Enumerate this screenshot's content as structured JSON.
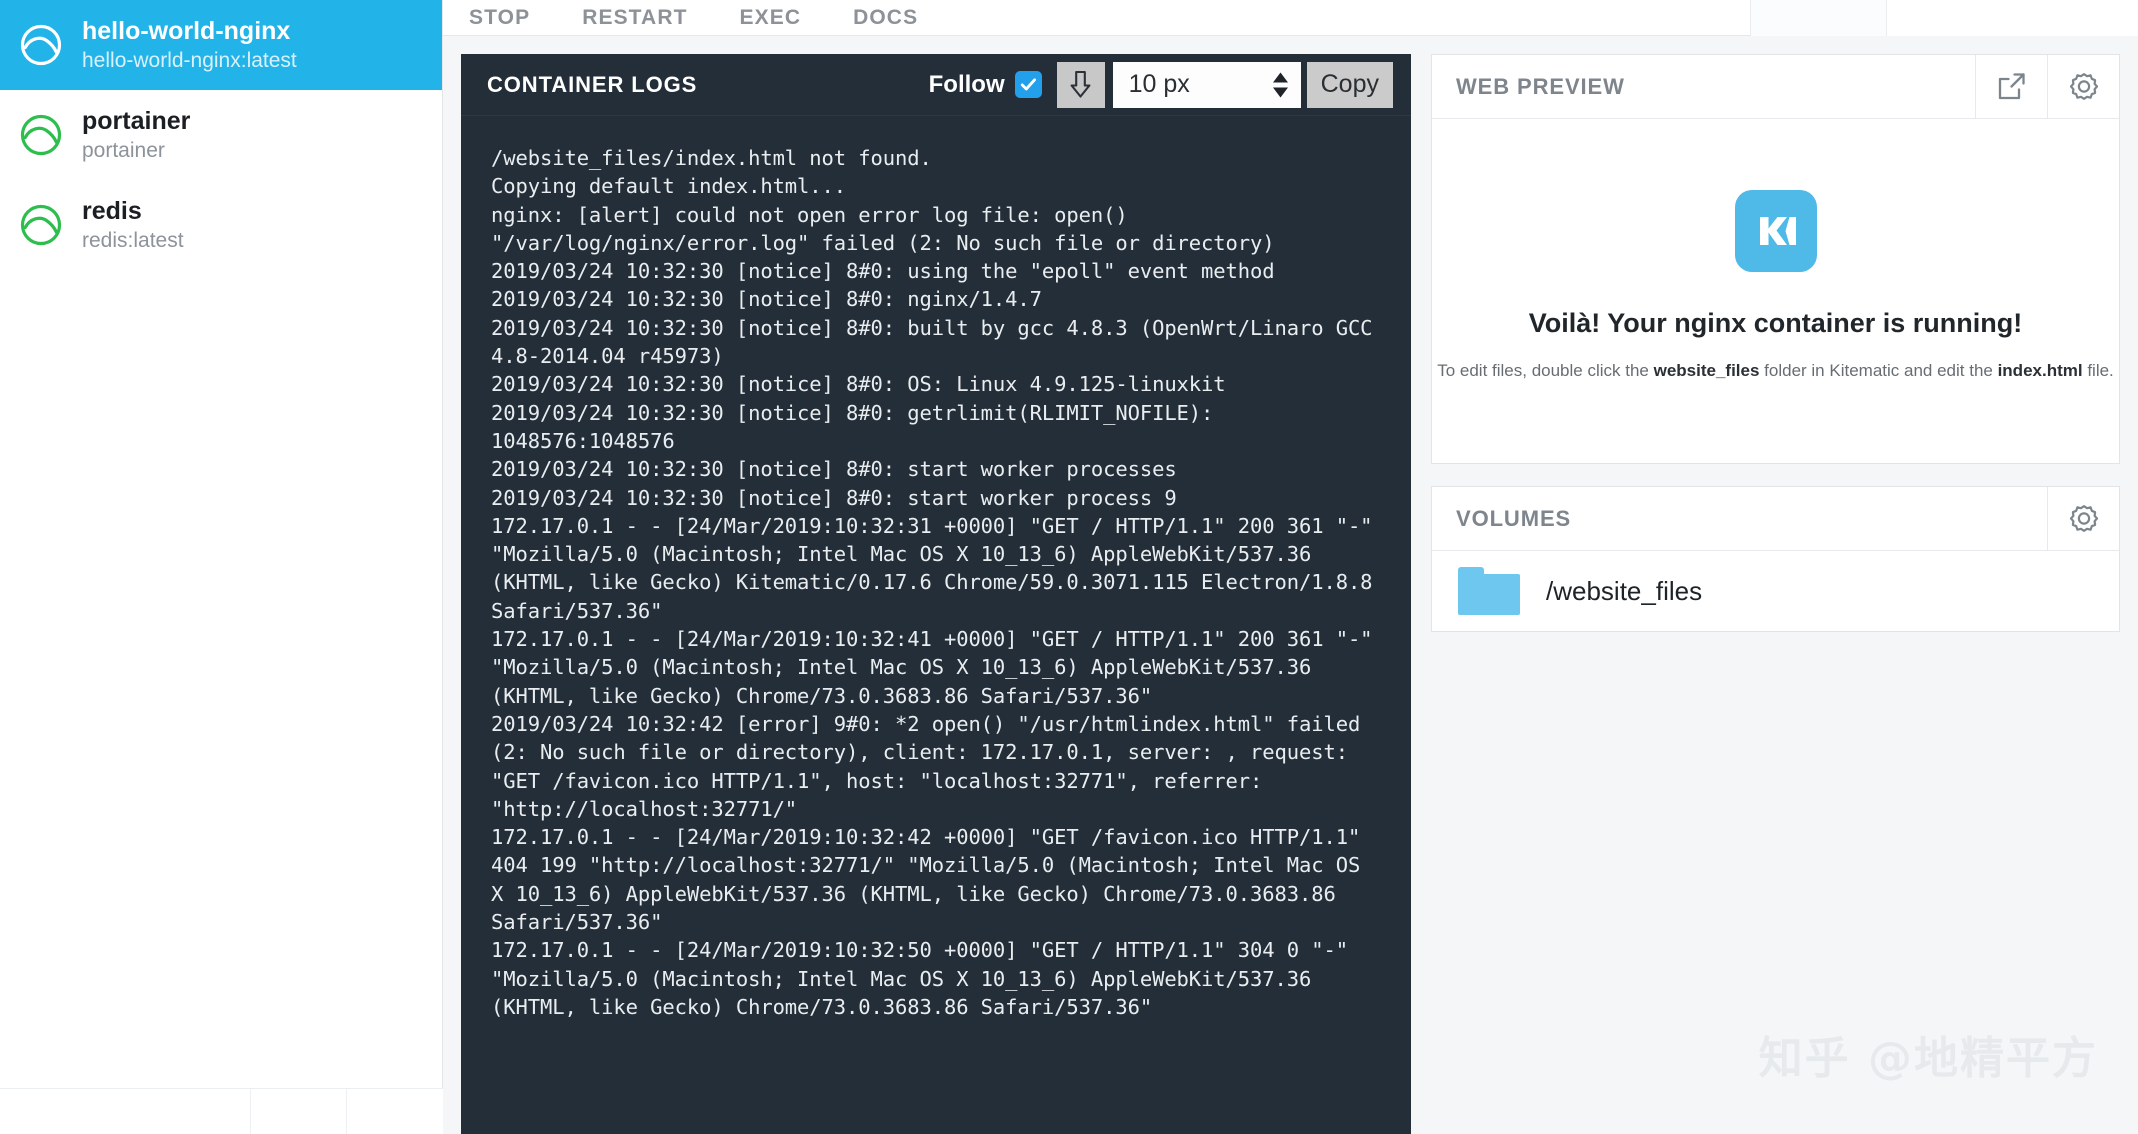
{
  "sidebar": {
    "containers": [
      {
        "name": "hello-world-nginx",
        "image": "hello-world-nginx:latest",
        "state": "running",
        "selected": true
      },
      {
        "name": "portainer",
        "image": "portainer",
        "state": "running",
        "selected": false
      },
      {
        "name": "redis",
        "image": "redis:latest",
        "state": "running",
        "selected": false
      }
    ]
  },
  "toolbar": {
    "buttons": [
      {
        "label": "STOP"
      },
      {
        "label": "RESTART"
      },
      {
        "label": "EXEC"
      },
      {
        "label": "DOCS"
      }
    ]
  },
  "logs": {
    "title": "CONTAINER LOGS",
    "follow_label": "Follow",
    "follow_checked": true,
    "scroll_icon": "download-arrow-icon",
    "font_size_value": "10 px",
    "copy_label": "Copy",
    "text": "/website_files/index.html not found.\nCopying default index.html...\nnginx: [alert] could not open error log file: open()\n\"/var/log/nginx/error.log\" failed (2: No such file or directory)\n2019/03/24 10:32:30 [notice] 8#0: using the \"epoll\" event method\n2019/03/24 10:32:30 [notice] 8#0: nginx/1.4.7\n2019/03/24 10:32:30 [notice] 8#0: built by gcc 4.8.3 (OpenWrt/Linaro GCC\n4.8-2014.04 r45973)\n2019/03/24 10:32:30 [notice] 8#0: OS: Linux 4.9.125-linuxkit\n2019/03/24 10:32:30 [notice] 8#0: getrlimit(RLIMIT_NOFILE):\n1048576:1048576\n2019/03/24 10:32:30 [notice] 8#0: start worker processes\n2019/03/24 10:32:30 [notice] 8#0: start worker process 9\n172.17.0.1 - - [24/Mar/2019:10:32:31 +0000] \"GET / HTTP/1.1\" 200 361 \"-\"\n\"Mozilla/5.0 (Macintosh; Intel Mac OS X 10_13_6) AppleWebKit/537.36\n(KHTML, like Gecko) Kitematic/0.17.6 Chrome/59.0.3071.115 Electron/1.8.8\nSafari/537.36\"\n172.17.0.1 - - [24/Mar/2019:10:32:41 +0000] \"GET / HTTP/1.1\" 200 361 \"-\"\n\"Mozilla/5.0 (Macintosh; Intel Mac OS X 10_13_6) AppleWebKit/537.36\n(KHTML, like Gecko) Chrome/73.0.3683.86 Safari/537.36\"\n2019/03/24 10:32:42 [error] 9#0: *2 open() \"/usr/htmlindex.html\" failed\n(2: No such file or directory), client: 172.17.0.1, server: , request:\n\"GET /favicon.ico HTTP/1.1\", host: \"localhost:32771\", referrer:\n\"http://localhost:32771/\"\n172.17.0.1 - - [24/Mar/2019:10:32:42 +0000] \"GET /favicon.ico HTTP/1.1\"\n404 199 \"http://localhost:32771/\" \"Mozilla/5.0 (Macintosh; Intel Mac OS\nX 10_13_6) AppleWebKit/537.36 (KHTML, like Gecko) Chrome/73.0.3683.86\nSafari/537.36\"\n172.17.0.1 - - [24/Mar/2019:10:32:50 +0000] \"GET / HTTP/1.1\" 304 0 \"-\"\n\"Mozilla/5.0 (Macintosh; Intel Mac OS X 10_13_6) AppleWebKit/537.36\n(KHTML, like Gecko) Chrome/73.0.3683.86 Safari/537.36\""
  },
  "web_preview": {
    "title": "WEB PREVIEW",
    "open_external_icon": "external-link-icon",
    "settings_icon": "gear-icon",
    "logo_text": "K",
    "heading": "Voilà! Your nginx container is running!",
    "subtext_part1": "To edit files, double click the ",
    "subtext_bold1": "website_files",
    "subtext_part2": " folder in Kitematic and edit the ",
    "subtext_bold2": "index.html",
    "subtext_part3": " file."
  },
  "volumes": {
    "title": "VOLUMES",
    "settings_icon": "gear-icon",
    "items": [
      {
        "path": "/website_files",
        "icon": "folder-icon"
      }
    ]
  },
  "watermark": {
    "text": "知乎 @地精平方"
  },
  "colors": {
    "accent_blue": "#22b4e8",
    "logs_background": "#232e38",
    "running_green": "#2dbe4e",
    "checkbox_blue": "#22a0eb",
    "folder_blue": "#6ec7ef"
  }
}
